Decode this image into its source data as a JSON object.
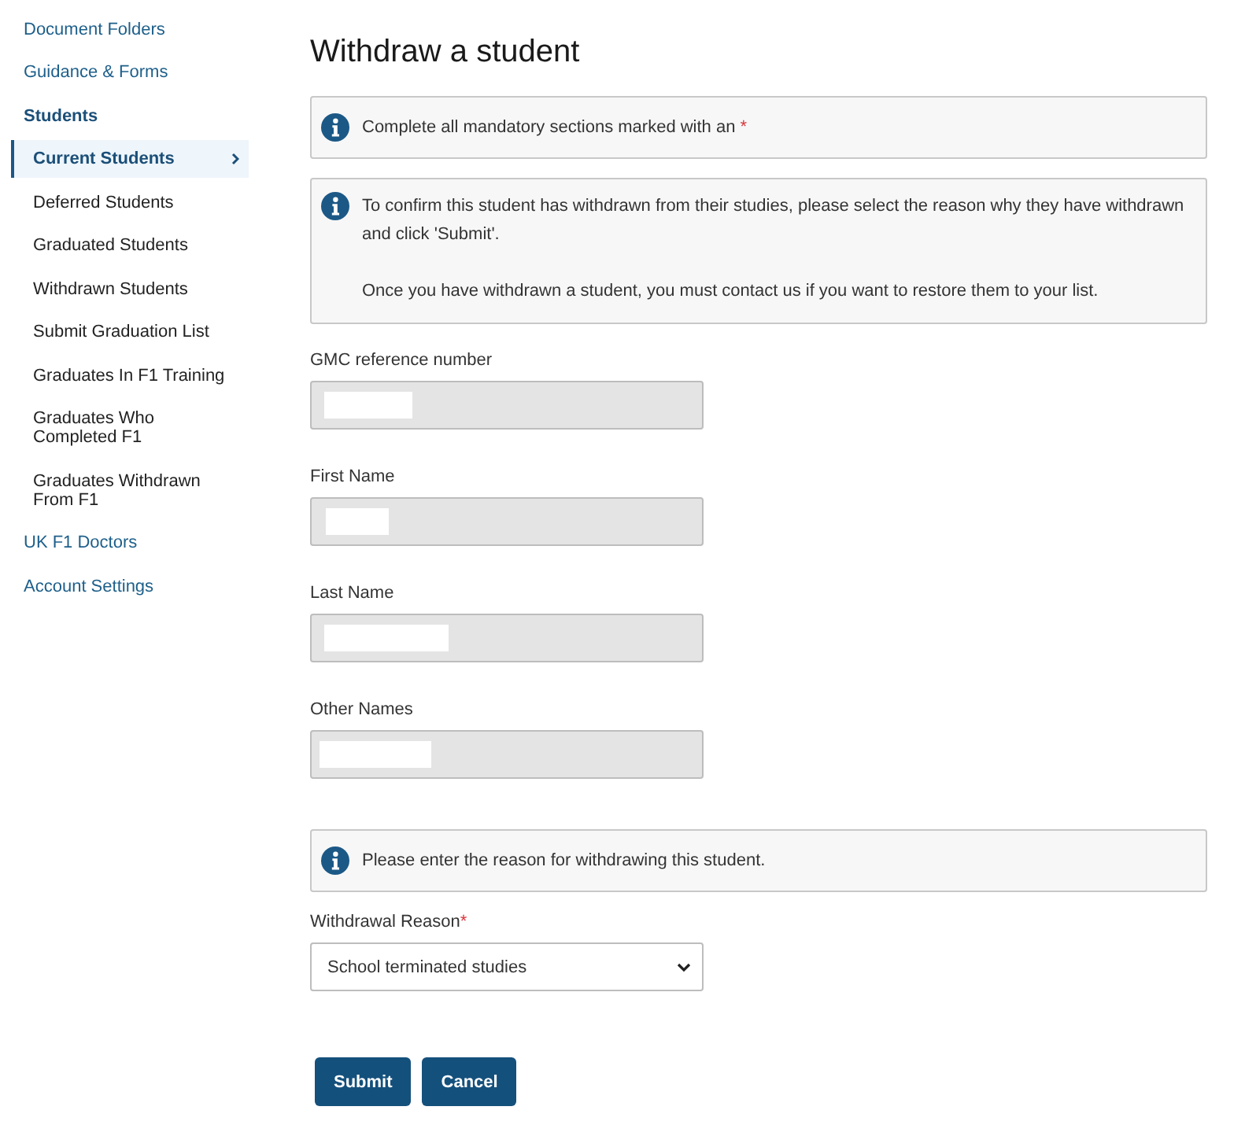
{
  "sidebar": {
    "items": [
      {
        "label": "Document Folders",
        "active": false
      },
      {
        "label": "Guidance & Forms",
        "active": false
      },
      {
        "label": "Students",
        "active": true,
        "children": [
          {
            "label": "Current Students",
            "selected": true
          },
          {
            "label": "Deferred Students",
            "selected": false
          },
          {
            "label": "Graduated Students",
            "selected": false
          },
          {
            "label": "Withdrawn Students",
            "selected": false
          },
          {
            "label": "Submit Graduation List",
            "selected": false
          },
          {
            "label": "Graduates In F1 Training",
            "selected": false
          },
          {
            "label": "Graduates Who Completed F1",
            "selected": false
          },
          {
            "label": "Graduates Withdrawn From F1",
            "selected": false
          }
        ]
      },
      {
        "label": "UK F1 Doctors",
        "active": false
      },
      {
        "label": "Account Settings",
        "active": false
      }
    ]
  },
  "page": {
    "title": "Withdraw a student"
  },
  "notices": [
    {
      "paragraphs": [
        "Complete all mandatory sections marked with an"
      ],
      "required_marker": "*"
    },
    {
      "paragraphs": [
        "To confirm this student has withdrawn from their studies, please select the reason why they have withdrawn and click 'Submit'.",
        "Once you have withdrawn a student, you must contact us if you want to restore them to your list."
      ]
    }
  ],
  "fields": [
    {
      "label": "GMC reference number",
      "disabled": true,
      "redacted": true
    },
    {
      "label": "First Name",
      "disabled": true,
      "redacted": true
    },
    {
      "label": "Last Name",
      "disabled": true,
      "redacted": true
    },
    {
      "label": "Other Names",
      "disabled": true,
      "redacted": true
    }
  ],
  "reason_notice": {
    "paragraphs": [
      "Please enter the reason for withdrawing this student."
    ]
  },
  "reason": {
    "label": "Withdrawal Reason",
    "required_marker": "*",
    "value": "School terminated studies"
  },
  "buttons": [
    {
      "label": "Submit"
    },
    {
      "label": "Cancel"
    }
  ]
}
